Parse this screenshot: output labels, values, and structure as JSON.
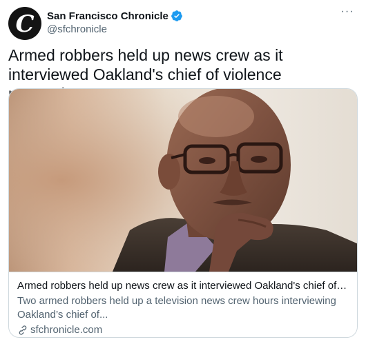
{
  "account": {
    "name": "San Francisco Chronicle",
    "handle": "@sfchronicle",
    "avatar_icon": "sf-chronicle-logo-icon",
    "avatar_letter": "C",
    "verified_icon": "verified-badge-icon",
    "verified_color": "#1d9bf0"
  },
  "more_label": "···",
  "tweet": {
    "text": "Armed robbers held up news crew as it interviewed Oakland's chief of violence prevention:"
  },
  "card": {
    "image_icon": "photo-man-with-glasses-hand-on-chin",
    "title": "Armed robbers held up news crew as it interviewed Oakland's chief of violen...",
    "description": "Two armed robbers held up a television news crew hours interviewing Oakland’s chief of...",
    "domain": "sfchronicle.com",
    "link_icon": "link-icon"
  },
  "colors": {
    "text_primary": "#0f1419",
    "text_secondary": "#536471",
    "border": "#cfd9de"
  }
}
